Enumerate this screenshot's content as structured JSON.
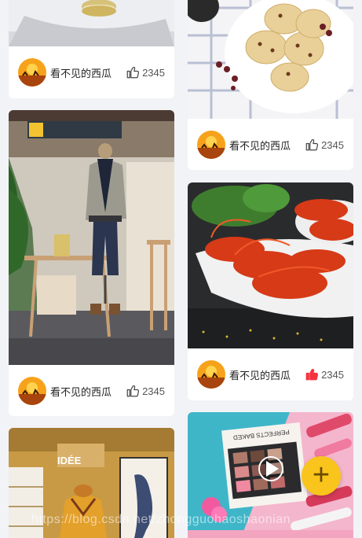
{
  "feed": {
    "cards": [
      {
        "author": "看不见的西瓜",
        "likes": "2345",
        "liked": false
      },
      {
        "author": "看不见的西瓜",
        "likes": "2345",
        "liked": false
      },
      {
        "author": "看不见的西瓜",
        "likes": "2345",
        "liked": false
      },
      {
        "author": "看不见的西瓜",
        "likes": "2345",
        "liked": true
      }
    ],
    "store_sign_1": "1F",
    "store_sign_2": "IDÉE",
    "palette_label": "PERFECTS BAKED"
  },
  "colors": {
    "liked": "#f5333f",
    "fab": "#f9c51c",
    "background": "#f2f3f7"
  },
  "icons": {
    "like": "thumbs-up-icon",
    "fab": "plus-icon",
    "play": "play-icon"
  },
  "watermark": "https://blog.csdn.net/zhongguohaoshaonian"
}
